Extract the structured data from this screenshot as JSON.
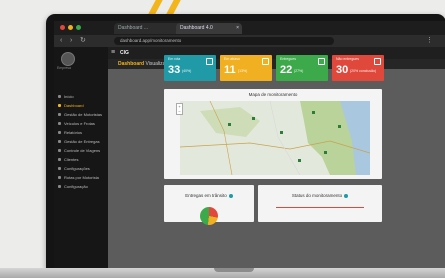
{
  "browser": {
    "tabs": [
      {
        "label": "Dashboard ..."
      },
      {
        "label": "Dashboard 4.0"
      }
    ],
    "url": "dashboard.app/monitoramento"
  },
  "topbar": {
    "brand": "CIG"
  },
  "breadcrumb": {
    "section": "Dashboard",
    "page": "Visualização do Veículo ▸"
  },
  "sidebar": {
    "logo_caption": "Empresa",
    "items": [
      {
        "label": "Início"
      },
      {
        "label": "Dashboard"
      },
      {
        "label": "Gestão de Motoristas"
      },
      {
        "label": "Veículos e Frotas"
      },
      {
        "label": "Relatórios"
      },
      {
        "label": "Gestão de Entregas"
      },
      {
        "label": "Controle de Viagens"
      },
      {
        "label": "Clientes"
      },
      {
        "label": "Configurações"
      },
      {
        "label": "Rotas por Motorista"
      },
      {
        "label": "Configuração"
      }
    ]
  },
  "kpis": [
    {
      "label": "Em rota",
      "value": "33",
      "pct": "(40%)",
      "color": "#1f9aa6"
    },
    {
      "label": "Em atraso",
      "value": "11",
      "pct": "(13%)",
      "color": "#f0b021"
    },
    {
      "label": "Entregues",
      "value": "22",
      "pct": "(27%)",
      "color": "#3caa4a"
    },
    {
      "label": "Não entregues",
      "value": "30",
      "pct": "(20% conclusão)",
      "color": "#e0483b"
    }
  ],
  "map": {
    "title": "Mapa de monitoramento",
    "zoom_in": "+",
    "zoom_out": "−"
  },
  "cards": {
    "deliveries_title": "Entregas em trânsito",
    "status_title": "Status do monitoramento"
  },
  "colors": {
    "accent": "#f2b51c"
  }
}
